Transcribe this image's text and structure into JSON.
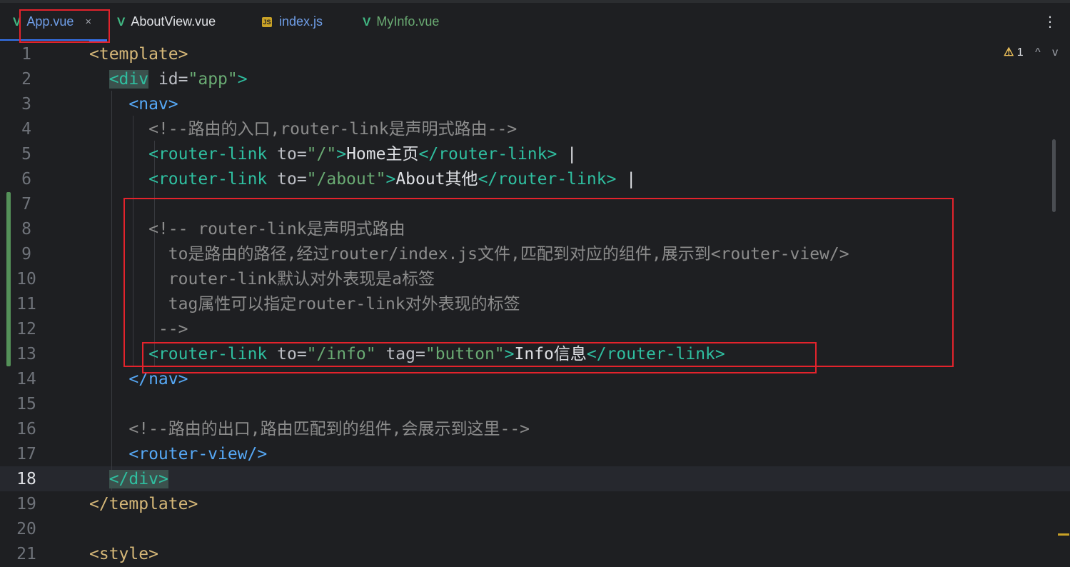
{
  "tabs": [
    {
      "label": "App.vue",
      "icon": "vue-icon",
      "active": true,
      "closable": true
    },
    {
      "label": "AboutView.vue",
      "icon": "vue-icon",
      "active": false
    },
    {
      "label": "index.js",
      "icon": "js-icon",
      "active": false
    },
    {
      "label": "MyInfo.vue",
      "icon": "vue-icon",
      "active": false
    }
  ],
  "tab_icons": {
    "vue": "V",
    "js": "JS",
    "close": "×",
    "kebab": "⋮"
  },
  "editor": {
    "current_line": 18,
    "line_numbers": [
      "1",
      "2",
      "3",
      "4",
      "5",
      "6",
      "7",
      "8",
      "9",
      "10",
      "11",
      "12",
      "13",
      "14",
      "15",
      "16",
      "17",
      "18",
      "19",
      "20",
      "21"
    ],
    "lines": [
      [
        {
          "t": "tg",
          "v": "<template>"
        }
      ],
      [
        {
          "t": "ws",
          "v": "  "
        },
        {
          "t": "tl",
          "v": "<div",
          "m": true
        },
        {
          "t": "at",
          "v": " id"
        },
        {
          "t": "op",
          "v": "="
        },
        {
          "t": "st",
          "v": "\"app\""
        },
        {
          "t": "tl",
          "v": ">"
        }
      ],
      [
        {
          "t": "ws",
          "v": "    "
        },
        {
          "t": "nt",
          "v": "<nav>"
        }
      ],
      [
        {
          "t": "ws",
          "v": "      "
        },
        {
          "t": "cm",
          "v": "<!--路由的入口,router-link是声明式路由-->"
        }
      ],
      [
        {
          "t": "ws",
          "v": "      "
        },
        {
          "t": "tl",
          "v": "<router-link"
        },
        {
          "t": "at",
          "v": " to"
        },
        {
          "t": "op",
          "v": "="
        },
        {
          "t": "st",
          "v": "\"/\""
        },
        {
          "t": "tl",
          "v": ">"
        },
        {
          "t": "tx",
          "v": "Home主页"
        },
        {
          "t": "tl",
          "v": "</router-link>"
        },
        {
          "t": "tx",
          "v": " |"
        }
      ],
      [
        {
          "t": "ws",
          "v": "      "
        },
        {
          "t": "tl",
          "v": "<router-link"
        },
        {
          "t": "at",
          "v": " to"
        },
        {
          "t": "op",
          "v": "="
        },
        {
          "t": "st",
          "v": "\"/about\""
        },
        {
          "t": "tl",
          "v": ">"
        },
        {
          "t": "tx",
          "v": "About其他"
        },
        {
          "t": "tl",
          "v": "</router-link>"
        },
        {
          "t": "tx",
          "v": " |"
        }
      ],
      [],
      [
        {
          "t": "ws",
          "v": "      "
        },
        {
          "t": "cm",
          "v": "<!-- router-link是声明式路由"
        }
      ],
      [
        {
          "t": "ws",
          "v": "        "
        },
        {
          "t": "cm",
          "v": "to是路由的路径,经过router/index.js文件,匹配到对应的组件,展示到<router-view/>"
        }
      ],
      [
        {
          "t": "ws",
          "v": "        "
        },
        {
          "t": "cm",
          "v": "router-link默认对外表现是a标签"
        }
      ],
      [
        {
          "t": "ws",
          "v": "        "
        },
        {
          "t": "cm",
          "v": "tag属性可以指定router-link对外表现的标签"
        }
      ],
      [
        {
          "t": "ws",
          "v": "       "
        },
        {
          "t": "cm",
          "v": "-->"
        }
      ],
      [
        {
          "t": "ws",
          "v": "      "
        },
        {
          "t": "tl",
          "v": "<router-link"
        },
        {
          "t": "at",
          "v": " to"
        },
        {
          "t": "op",
          "v": "="
        },
        {
          "t": "st",
          "v": "\"/info\""
        },
        {
          "t": "at",
          "v": " tag"
        },
        {
          "t": "op",
          "v": "="
        },
        {
          "t": "st",
          "v": "\"button\""
        },
        {
          "t": "tl",
          "v": ">"
        },
        {
          "t": "tx",
          "v": "Info信息"
        },
        {
          "t": "tl",
          "v": "</router-link>"
        }
      ],
      [
        {
          "t": "ws",
          "v": "    "
        },
        {
          "t": "nt",
          "v": "</nav>"
        }
      ],
      [],
      [
        {
          "t": "ws",
          "v": "    "
        },
        {
          "t": "cm",
          "v": "<!--路由的出口,路由匹配到的组件,会展示到这里-->"
        }
      ],
      [
        {
          "t": "ws",
          "v": "    "
        },
        {
          "t": "nt",
          "v": "<router-view/>"
        }
      ],
      [
        {
          "t": "ws",
          "v": "  "
        },
        {
          "t": "tl",
          "v": "</div>",
          "m": true
        }
      ],
      [
        {
          "t": "tg",
          "v": "</template>"
        }
      ],
      [],
      [
        {
          "t": "tg",
          "v": "<style>"
        }
      ]
    ]
  },
  "inspection": {
    "warning_icon": "⚠",
    "count": "1",
    "up": "^",
    "down": "v"
  }
}
